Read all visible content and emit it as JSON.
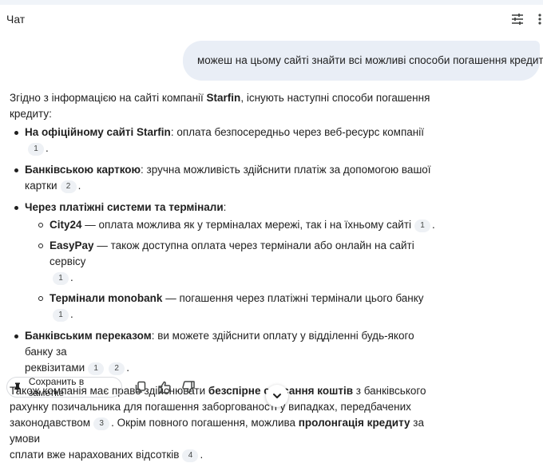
{
  "header": {
    "title": "Чат",
    "tune_icon": "tune-icon",
    "more_icon": "more-vert-icon"
  },
  "user_message": {
    "text": "можеш на цьому сайті знайти всі можливі способи погашення кредиту"
  },
  "answer": {
    "intro_1": "Згідно з інформацією на сайті компанії ",
    "intro_bold": "Starfin",
    "intro_2": ", існують наступні способи погашення",
    "intro_3": "кредиту:",
    "items": [
      {
        "bold": "На офіційному сайті Starfin",
        "text": ": оплата безпосередньо через веб-ресурс компанії",
        "cite": "1",
        "end": "."
      },
      {
        "bold": "Банківською карткою",
        "text": ": зручна можливість здійснити платіж за допомогою вашої",
        "text_2": "картки",
        "cite": "2",
        "end": "."
      },
      {
        "bold": "Через платіжні системи та термінали",
        "text": ":",
        "sub": [
          {
            "bold": "City24",
            "text": " — оплата можлива як у терміналах мережі, так і на їхньому сайті",
            "cite": "1",
            "end": "."
          },
          {
            "bold": "EasyPay",
            "text": " — також доступна оплата через термінали або онлайн на сайті сервісу",
            "cite": "1",
            "end": "."
          },
          {
            "bold": "Термінали monobank",
            "text": " — погашення через платіжні термінали цього банку",
            "cite": "1",
            "end": "."
          }
        ]
      },
      {
        "bold": "Банківським переказом",
        "text": ": ви можете здійснити оплату у відділенні будь-якого банку за",
        "text_2": "реквізитами",
        "cite": "1",
        "cite_2": "2",
        "end": "."
      }
    ],
    "outro_1": "Також компанія має право здійснювати ",
    "outro_bold_1": "безспірне списання коштів",
    "outro_2": " з банківського",
    "outro_3": "рахунку позичальника для погашення заборгованості у випадках, передбачених",
    "outro_4": "законодавством",
    "outro_cite_1": "3",
    "outro_5": ". Окрім повного погашення, можлива ",
    "outro_bold_2": "пролонгація кредиту",
    "outro_6": " за умови",
    "outro_7": "сплати вже нарахованих відсотків",
    "outro_cite_2": "4",
    "outro_end": "."
  },
  "actions": {
    "save_label": "Сохранить в заметке",
    "copy_icon": "copy-icon",
    "like_icon": "thumb-up-icon",
    "dislike_icon": "thumb-down-icon",
    "scroll_icon": "chevron-down-icon"
  }
}
